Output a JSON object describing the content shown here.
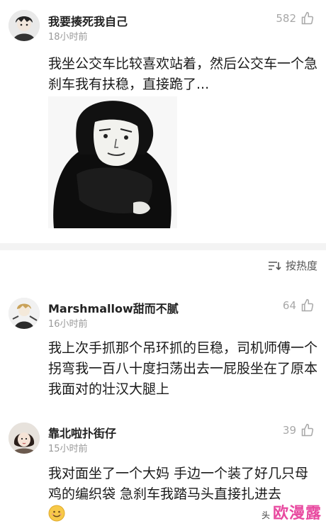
{
  "comments": [
    {
      "username": "我要揍死我自己",
      "time": "18小时前",
      "likes": "582",
      "text": "我坐公交车比较喜欢站着，然后公交车一个急刹车我有扶稳，直接跪了..."
    },
    {
      "username": "Marshmallow甜而不腻",
      "time": "16小时前",
      "likes": "64",
      "text": "我上次手抓那个吊环抓的巨稳，司机师傅一个拐弯我一百八十度扫荡出去一屁股坐在了原本我面对的壮汉大腿上"
    },
    {
      "username": "靠北啦扑街仔",
      "time": "15小时前",
      "likes": "39",
      "text": "我对面坐了一个大妈 手边一个装了好几只母鸡的编织袋 急刹车我踏马头直接扎进去"
    }
  ],
  "sort_label": "按热度",
  "icons": {
    "like": "thumbs-up-icon",
    "sort": "sort-icon",
    "emoji": "smile-emoji-icon"
  },
  "watermark": {
    "small": "头",
    "big": "欧漫露"
  },
  "colors": {
    "watermark": "#e84aa0",
    "muted": "#9a9a9a"
  }
}
